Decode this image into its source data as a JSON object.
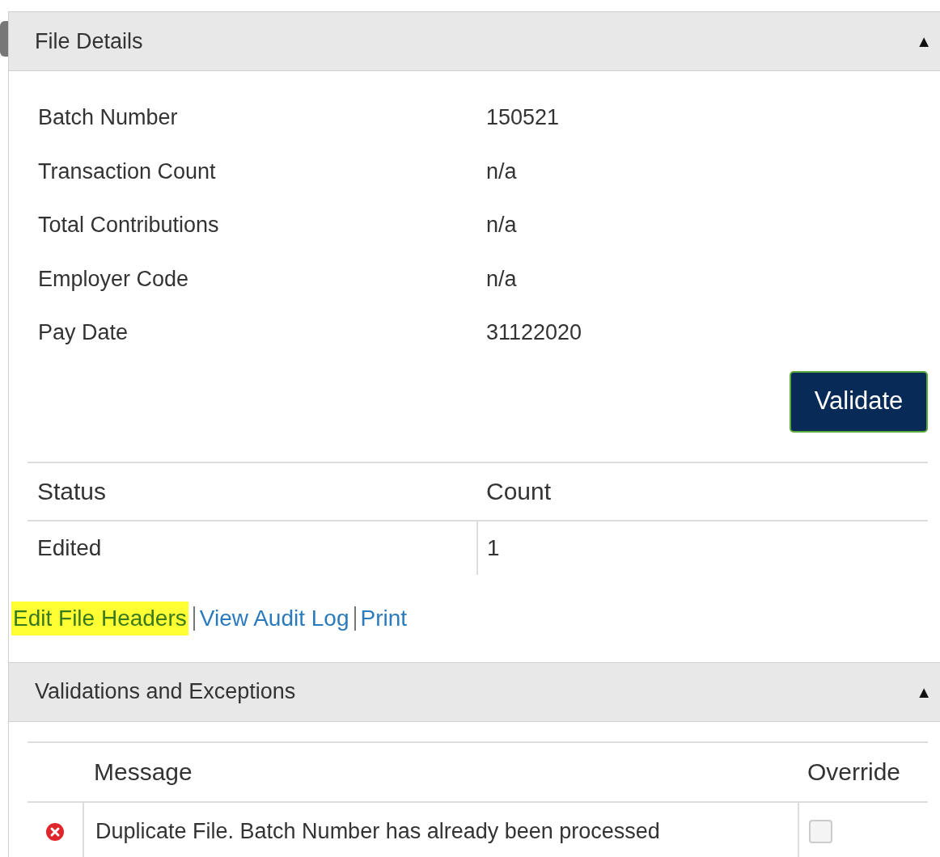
{
  "file_details": {
    "title": "File Details",
    "toggle": "▲",
    "expanded": true,
    "fields": [
      {
        "label": "Batch Number",
        "value": "150521"
      },
      {
        "label": "Transaction Count",
        "value": "n/a"
      },
      {
        "label": "Total Contributions",
        "value": "n/a"
      },
      {
        "label": "Employer Code",
        "value": "n/a"
      },
      {
        "label": "Pay Date",
        "value": "31122020"
      }
    ],
    "validate_button": "Validate",
    "status_table": {
      "columns": [
        "Status",
        "Count"
      ],
      "rows": [
        [
          "Edited",
          "1"
        ]
      ]
    }
  },
  "links": [
    {
      "label": "Edit File Headers",
      "highlighted": true
    },
    {
      "label": "View Audit Log",
      "highlighted": false
    },
    {
      "label": "Print",
      "highlighted": false
    }
  ],
  "validations": {
    "title": "Validations and Exceptions",
    "toggle": "▲",
    "expanded": true,
    "columns": [
      "Message",
      "Override"
    ],
    "rows": [
      {
        "kind": "error",
        "message": "Duplicate File. Batch Number has already been processed",
        "override": false
      }
    ]
  }
}
